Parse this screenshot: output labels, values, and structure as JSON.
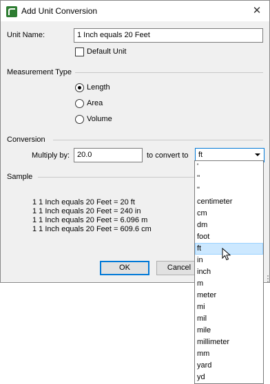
{
  "window": {
    "title": "Add Unit Conversion",
    "close_glyph": "✕"
  },
  "unit_name": {
    "label": "Unit Name:",
    "value": "1 Inch equals 20 Feet"
  },
  "default_unit": {
    "label": "Default Unit",
    "checked": false
  },
  "measurement_type": {
    "heading": "Measurement Type",
    "options": [
      {
        "label": "Length",
        "selected": true
      },
      {
        "label": "Area",
        "selected": false
      },
      {
        "label": "Volume",
        "selected": false
      }
    ]
  },
  "conversion": {
    "heading": "Conversion",
    "multiply_label": "Multiply by:",
    "multiply_value": "20.0",
    "convert_label": "to convert to",
    "selected_unit": "ft"
  },
  "sample": {
    "heading": "Sample",
    "lines": [
      "1 1 Inch equals 20 Feet = 20 ft",
      "1 1 Inch equals 20 Feet = 240 in",
      "1 1 Inch equals 20 Feet = 6.096 m",
      "1 1 Inch equals 20 Feet = 609.6 cm"
    ]
  },
  "buttons": {
    "ok": "OK",
    "cancel": "Cancel"
  },
  "dropdown_options": [
    "'",
    "''",
    "\"",
    "centimeter",
    "cm",
    "dm",
    "foot",
    "ft",
    "in",
    "inch",
    "m",
    "meter",
    "mi",
    "mil",
    "mile",
    "millimeter",
    "mm",
    "yard",
    "yd"
  ],
  "dropdown_selected_index": 7,
  "colors": {
    "accent": "#0078d7",
    "selection_bg": "#cce8ff",
    "dialog_bg": "#f0f0f0",
    "app_icon": "#2e7d32"
  }
}
